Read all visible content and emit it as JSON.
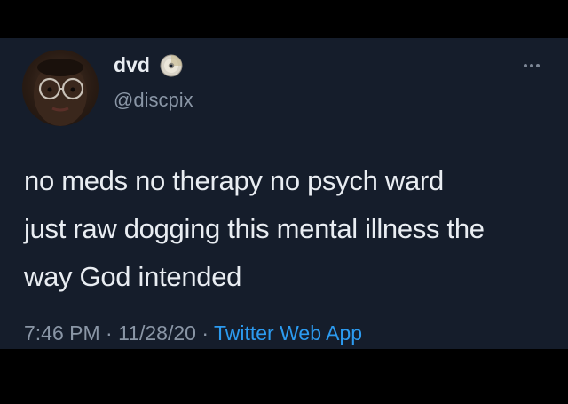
{
  "tweet": {
    "author": {
      "display_name": "dvd",
      "handle": "@discpix",
      "badge_icon": "disc-icon",
      "avatar_icon": "profile-photo"
    },
    "text_lines": [
      "no meds no therapy no psych ward",
      "just raw dogging this mental illness the",
      "way God intended"
    ],
    "meta": {
      "time": "7:46 PM",
      "separator": "·",
      "date": "11/28/20",
      "source": "Twitter Web App"
    },
    "more_icon": "more-options-icon"
  },
  "colors": {
    "card_background": "#151d2b",
    "frame_background": "#000000",
    "primary_text": "#e9edf2",
    "secondary_text": "#8a96a6",
    "link": "#2c9bf0"
  }
}
